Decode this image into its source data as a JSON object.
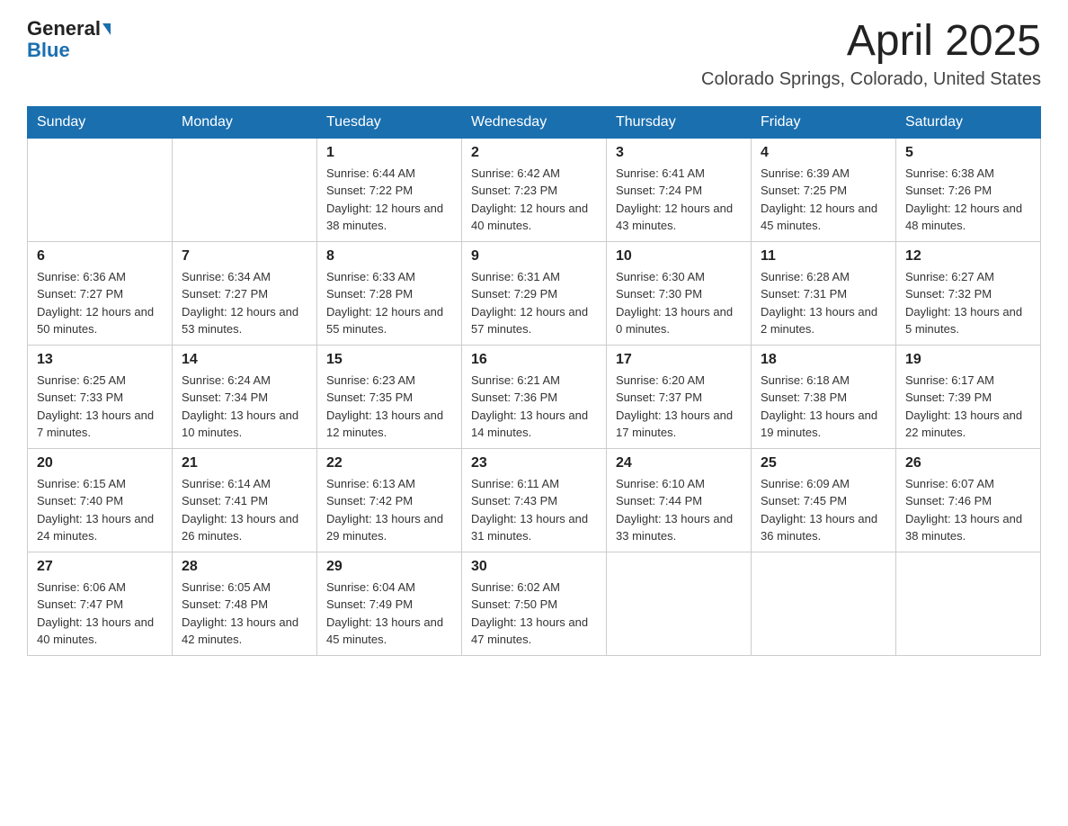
{
  "logo": {
    "general": "General",
    "blue": "Blue"
  },
  "header": {
    "month_title": "April 2025",
    "location": "Colorado Springs, Colorado, United States"
  },
  "days_of_week": [
    "Sunday",
    "Monday",
    "Tuesday",
    "Wednesday",
    "Thursday",
    "Friday",
    "Saturday"
  ],
  "weeks": [
    [
      {
        "day": "",
        "sunrise": "",
        "sunset": "",
        "daylight": ""
      },
      {
        "day": "",
        "sunrise": "",
        "sunset": "",
        "daylight": ""
      },
      {
        "day": "1",
        "sunrise": "Sunrise: 6:44 AM",
        "sunset": "Sunset: 7:22 PM",
        "daylight": "Daylight: 12 hours and 38 minutes."
      },
      {
        "day": "2",
        "sunrise": "Sunrise: 6:42 AM",
        "sunset": "Sunset: 7:23 PM",
        "daylight": "Daylight: 12 hours and 40 minutes."
      },
      {
        "day": "3",
        "sunrise": "Sunrise: 6:41 AM",
        "sunset": "Sunset: 7:24 PM",
        "daylight": "Daylight: 12 hours and 43 minutes."
      },
      {
        "day": "4",
        "sunrise": "Sunrise: 6:39 AM",
        "sunset": "Sunset: 7:25 PM",
        "daylight": "Daylight: 12 hours and 45 minutes."
      },
      {
        "day": "5",
        "sunrise": "Sunrise: 6:38 AM",
        "sunset": "Sunset: 7:26 PM",
        "daylight": "Daylight: 12 hours and 48 minutes."
      }
    ],
    [
      {
        "day": "6",
        "sunrise": "Sunrise: 6:36 AM",
        "sunset": "Sunset: 7:27 PM",
        "daylight": "Daylight: 12 hours and 50 minutes."
      },
      {
        "day": "7",
        "sunrise": "Sunrise: 6:34 AM",
        "sunset": "Sunset: 7:27 PM",
        "daylight": "Daylight: 12 hours and 53 minutes."
      },
      {
        "day": "8",
        "sunrise": "Sunrise: 6:33 AM",
        "sunset": "Sunset: 7:28 PM",
        "daylight": "Daylight: 12 hours and 55 minutes."
      },
      {
        "day": "9",
        "sunrise": "Sunrise: 6:31 AM",
        "sunset": "Sunset: 7:29 PM",
        "daylight": "Daylight: 12 hours and 57 minutes."
      },
      {
        "day": "10",
        "sunrise": "Sunrise: 6:30 AM",
        "sunset": "Sunset: 7:30 PM",
        "daylight": "Daylight: 13 hours and 0 minutes."
      },
      {
        "day": "11",
        "sunrise": "Sunrise: 6:28 AM",
        "sunset": "Sunset: 7:31 PM",
        "daylight": "Daylight: 13 hours and 2 minutes."
      },
      {
        "day": "12",
        "sunrise": "Sunrise: 6:27 AM",
        "sunset": "Sunset: 7:32 PM",
        "daylight": "Daylight: 13 hours and 5 minutes."
      }
    ],
    [
      {
        "day": "13",
        "sunrise": "Sunrise: 6:25 AM",
        "sunset": "Sunset: 7:33 PM",
        "daylight": "Daylight: 13 hours and 7 minutes."
      },
      {
        "day": "14",
        "sunrise": "Sunrise: 6:24 AM",
        "sunset": "Sunset: 7:34 PM",
        "daylight": "Daylight: 13 hours and 10 minutes."
      },
      {
        "day": "15",
        "sunrise": "Sunrise: 6:23 AM",
        "sunset": "Sunset: 7:35 PM",
        "daylight": "Daylight: 13 hours and 12 minutes."
      },
      {
        "day": "16",
        "sunrise": "Sunrise: 6:21 AM",
        "sunset": "Sunset: 7:36 PM",
        "daylight": "Daylight: 13 hours and 14 minutes."
      },
      {
        "day": "17",
        "sunrise": "Sunrise: 6:20 AM",
        "sunset": "Sunset: 7:37 PM",
        "daylight": "Daylight: 13 hours and 17 minutes."
      },
      {
        "day": "18",
        "sunrise": "Sunrise: 6:18 AM",
        "sunset": "Sunset: 7:38 PM",
        "daylight": "Daylight: 13 hours and 19 minutes."
      },
      {
        "day": "19",
        "sunrise": "Sunrise: 6:17 AM",
        "sunset": "Sunset: 7:39 PM",
        "daylight": "Daylight: 13 hours and 22 minutes."
      }
    ],
    [
      {
        "day": "20",
        "sunrise": "Sunrise: 6:15 AM",
        "sunset": "Sunset: 7:40 PM",
        "daylight": "Daylight: 13 hours and 24 minutes."
      },
      {
        "day": "21",
        "sunrise": "Sunrise: 6:14 AM",
        "sunset": "Sunset: 7:41 PM",
        "daylight": "Daylight: 13 hours and 26 minutes."
      },
      {
        "day": "22",
        "sunrise": "Sunrise: 6:13 AM",
        "sunset": "Sunset: 7:42 PM",
        "daylight": "Daylight: 13 hours and 29 minutes."
      },
      {
        "day": "23",
        "sunrise": "Sunrise: 6:11 AM",
        "sunset": "Sunset: 7:43 PM",
        "daylight": "Daylight: 13 hours and 31 minutes."
      },
      {
        "day": "24",
        "sunrise": "Sunrise: 6:10 AM",
        "sunset": "Sunset: 7:44 PM",
        "daylight": "Daylight: 13 hours and 33 minutes."
      },
      {
        "day": "25",
        "sunrise": "Sunrise: 6:09 AM",
        "sunset": "Sunset: 7:45 PM",
        "daylight": "Daylight: 13 hours and 36 minutes."
      },
      {
        "day": "26",
        "sunrise": "Sunrise: 6:07 AM",
        "sunset": "Sunset: 7:46 PM",
        "daylight": "Daylight: 13 hours and 38 minutes."
      }
    ],
    [
      {
        "day": "27",
        "sunrise": "Sunrise: 6:06 AM",
        "sunset": "Sunset: 7:47 PM",
        "daylight": "Daylight: 13 hours and 40 minutes."
      },
      {
        "day": "28",
        "sunrise": "Sunrise: 6:05 AM",
        "sunset": "Sunset: 7:48 PM",
        "daylight": "Daylight: 13 hours and 42 minutes."
      },
      {
        "day": "29",
        "sunrise": "Sunrise: 6:04 AM",
        "sunset": "Sunset: 7:49 PM",
        "daylight": "Daylight: 13 hours and 45 minutes."
      },
      {
        "day": "30",
        "sunrise": "Sunrise: 6:02 AM",
        "sunset": "Sunset: 7:50 PM",
        "daylight": "Daylight: 13 hours and 47 minutes."
      },
      {
        "day": "",
        "sunrise": "",
        "sunset": "",
        "daylight": ""
      },
      {
        "day": "",
        "sunrise": "",
        "sunset": "",
        "daylight": ""
      },
      {
        "day": "",
        "sunrise": "",
        "sunset": "",
        "daylight": ""
      }
    ]
  ]
}
